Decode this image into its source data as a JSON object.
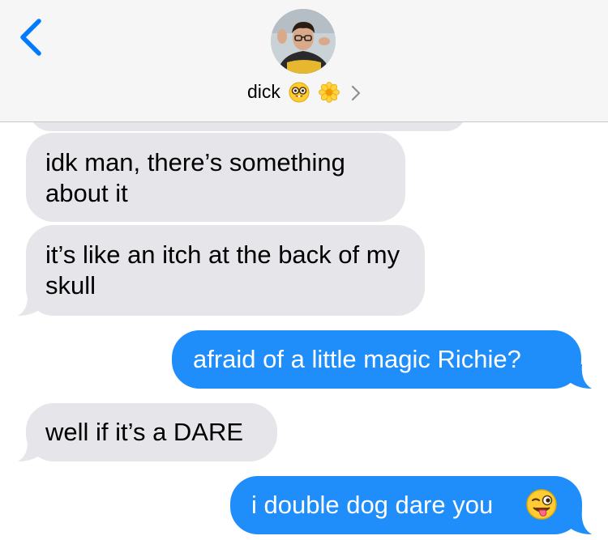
{
  "header": {
    "contact_name": "dick",
    "name_emojis": [
      "nerd-face-emoji",
      "blossom-emoji"
    ],
    "back_icon": "chevron-left-icon",
    "details_icon": "chevron-right-icon"
  },
  "colors": {
    "incoming_bubble": "#e5e5ea",
    "outgoing_bubble": "#1f8efa",
    "accent": "#007aff"
  },
  "messages": [
    {
      "from": "them",
      "text": ""
    },
    {
      "from": "them",
      "text": "idk man, there’s something about it"
    },
    {
      "from": "them",
      "text": "it’s like an itch at the back of my skull"
    },
    {
      "from": "me",
      "text": "afraid of a little magic Richie?"
    },
    {
      "from": "them",
      "text": "well if it’s a DARE"
    },
    {
      "from": "me",
      "text": "i double dog dare you",
      "trailing_emoji": "winking-tongue-face-emoji"
    }
  ]
}
